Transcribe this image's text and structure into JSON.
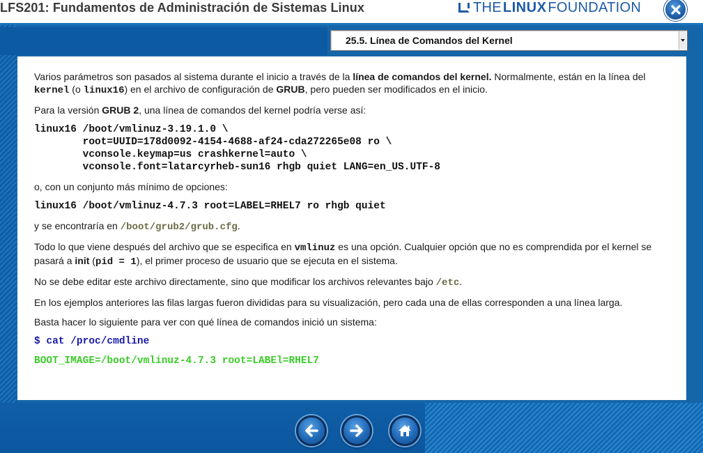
{
  "header": {
    "course_title": "LFS201: Fundamentos de Administración de Sistemas Linux",
    "logo_the": "THE",
    "logo_linux": "LINUX",
    "logo_foundation": "FOUNDATION"
  },
  "section_select": {
    "selected": "25.5. Línea de Comandos del Kernel"
  },
  "content": {
    "p1": {
      "t1": "Varios parámetros son pasados al sistema durante el inicio a través de la ",
      "b1": "línea de comandos del kernel.",
      "t2": " Normalmente, están en la línea del ",
      "c1": "kernel",
      "t3": " (o ",
      "c2": "linux16",
      "t4": ") en el archivo de configuración de ",
      "b2": "GRUB",
      "t5": ", pero pueden ser modificados en el inicio."
    },
    "p2": {
      "t1": "Para la versión ",
      "b1": "GRUB 2",
      "t2": ", una línea de comandos del kernel podría verse así:"
    },
    "code1": "linux16 /boot/vmlinuz-3.19.1.0 \\\n        root=UUID=178d0092-4154-4688-af24-cda272265e08 ro \\\n        vconsole.keymap=us crashkernel=auto \\\n        vconsole.font=latarcyrheb-sun16 rhgb quiet LANG=en_US.UTF-8",
    "p3": "o, con un conjunto más mínimo de opciones:",
    "code2": "linux16 /boot/vmlinuz-4.7.3 root=LABEL=RHEL7 ro rhgb quiet",
    "p4": {
      "t1": "y se encontraría en ",
      "path": "/boot/grub2/grub.cfg",
      "t2": "."
    },
    "p5": {
      "t1": "Todo lo que viene después del archivo que se especifica en ",
      "c1": "vmlinuz",
      "t2": " es una opción. Cualquier opción que no es comprendida por el kernel se pasará a ",
      "b1": "init",
      "t3": " (",
      "c2": "pid = 1",
      "t4": "),  el primer proceso de usuario que se ejecuta en el sistema."
    },
    "p6": {
      "t1": "No se debe editar este archivo directamente, sino que modificar los archivos relevantes bajo ",
      "path": "/etc",
      "t2": "."
    },
    "p7": "En los ejemplos anteriores las filas largas fueron divididas para su visualización, pero cada una de ellas corresponden a una línea larga.",
    "p8": "Basta hacer lo siguiente para ver con qué línea de comandos inició un sistema:",
    "cmd": "$ cat /proc/cmdline",
    "output": "BOOT_IMAGE=/boot/vmlinuz-4.7.3 root=LABEl=RHEL7"
  },
  "icons": {
    "close": "close-icon",
    "prev": "arrow-left-icon",
    "next": "arrow-right-icon",
    "home": "home-icon"
  },
  "colors": {
    "brand_blue": "#1b5aa6",
    "background": "#1565a9",
    "command": "#1a1aa8",
    "output": "#3ccc2a",
    "path": "#6b6b47"
  }
}
